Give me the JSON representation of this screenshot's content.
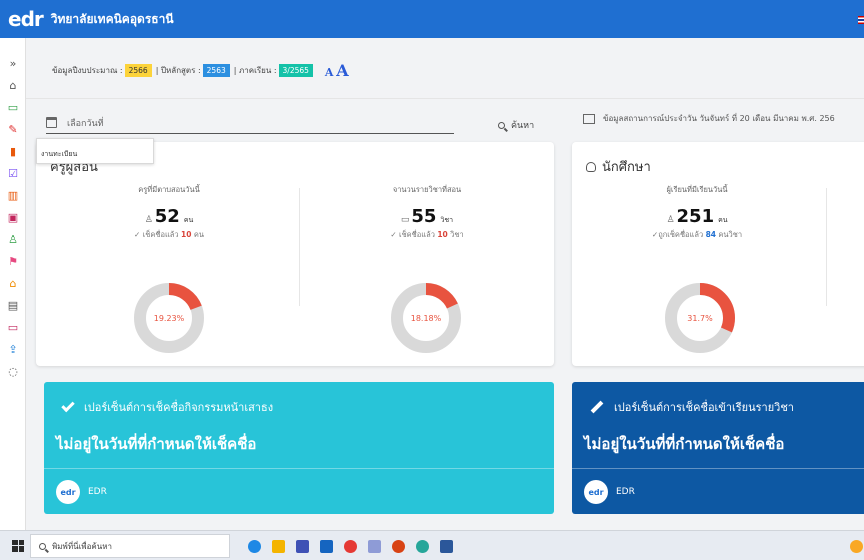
{
  "header": {
    "logo": "edr",
    "school_name": "วิทยาลัยเทคนิคอุดรธานี"
  },
  "sidebar": {
    "items": [
      "expand-icon",
      "home-icon",
      "monitor-icon",
      "pen-icon",
      "chart-icon",
      "checkbox-icon",
      "books-icon",
      "screen-icon",
      "user-icon",
      "flag-icon",
      "house-icon",
      "calendar-icon",
      "desk-icon",
      "share-icon",
      "chat-icon"
    ]
  },
  "info": {
    "budget_label": "ข้อมูลปีงบประมาณ :",
    "budget_year": "2566",
    "curriculum_label": "| ปีหลักสูตร :",
    "curriculum_year": "2563",
    "semester_label": "| ภาคเรียน :",
    "semester": "3/2565",
    "font_small": "A",
    "font_large": "A"
  },
  "filter": {
    "date_placeholder": "เลือกวันที่",
    "search_label": "ค้นหา",
    "status_text": "ข้อมูลสถานการณ์ประจำวัน วันจันทร์ ที่ 20 เดือน มีนาคม พ.ศ. 256",
    "dropdown_item": "งานทะเบียน"
  },
  "teachers_card": {
    "title": "ครูผู้สอน",
    "stat1": {
      "label": "ครูที่มีตาบสอนวันนี้",
      "value": "52",
      "unit": "คน",
      "check_prefix": "✓ เช็คชื่อแล้ว",
      "checked": "10",
      "check_unit": "คน"
    },
    "stat2": {
      "label": "จานวนรายวิชาที่สอน",
      "value": "55",
      "unit": "วิชา",
      "check_prefix": "✓ เช็คชื่อแล้ว",
      "checked": "10",
      "check_unit": "วิชา"
    },
    "donut1": {
      "percent_label": "19.23%",
      "percent": 19.23
    },
    "donut2": {
      "percent_label": "18.18%",
      "percent": 18.18
    }
  },
  "students_card": {
    "title": "นักศึกษา",
    "stat1": {
      "label": "ผู้เรียนที่มีเรียนวันนี้",
      "value": "251",
      "unit": "คน",
      "check_prefix": "✓ถูกเช็คชื่อแล้ว",
      "checked": "84",
      "check_unit": "คนวิชา"
    },
    "donut1": {
      "percent_label": "31.7%",
      "percent": 31.7
    }
  },
  "banner_activity": {
    "title": "เปอร์เซ็นต์การเช็คชื่อกิจกรรมหน้าเสาธง",
    "message": "ไม่อยู่ในวันที่ที่กำหนดให้เช็คชื่อ",
    "footer_logo": "edr",
    "footer_label": "EDR"
  },
  "banner_subject": {
    "title": "เปอร์เซ็นต์การเช็คชื่อเข้าเรียนรายวิชา",
    "message": "ไม่อยู่ในวันที่ที่กำหนดให้เช็คชื่อ",
    "footer_logo": "edr",
    "footer_label": "EDR"
  },
  "taskbar": {
    "search_placeholder": "พิมพ์ที่นี่เพื่อค้นหา"
  },
  "colors": {
    "header": "#1f6fd1",
    "donut_fill": "#e8533f",
    "donut_track": "#d9d9d9",
    "banner_cyan": "#28c4d8",
    "banner_blue": "#0d58a3"
  }
}
